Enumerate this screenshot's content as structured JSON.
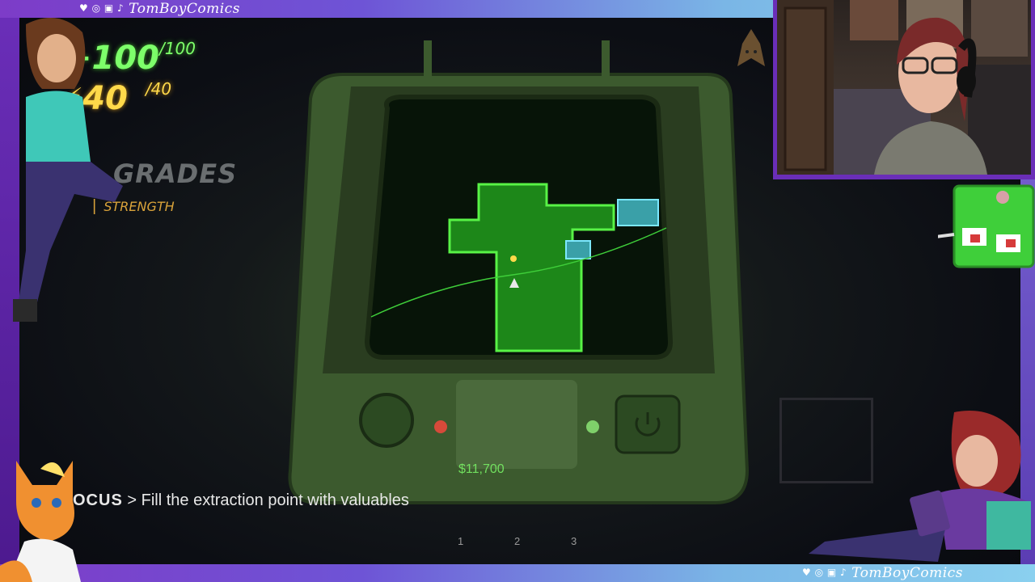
{
  "overlay": {
    "brand_top": "TomBoyComics",
    "brand_bottom": "TomBoyComics",
    "social_icons": "♥ ◎ ▣ ♪",
    "colors": {
      "frame_purple": "#6a2eb8",
      "frame_blue": "#8ad0ef",
      "hud_green": "#7dff6a",
      "hud_yellow": "#ffd94a"
    }
  },
  "hud": {
    "health_prefix": "+",
    "health": "100",
    "health_max": "/100",
    "energy_prefix": "⚡",
    "energy": "40",
    "energy_max": "/40",
    "upgrades_title": "GRADES",
    "upgrade_item": "STRENGTH"
  },
  "monitor": {
    "money": "$11,700"
  },
  "objective": {
    "label": "OCUS",
    "arrow": ">",
    "text": "Fill the extraction point with valuables"
  },
  "inventory": {
    "slots": [
      "1",
      "2",
      "3"
    ]
  },
  "icons": {
    "top_right": "bat-icon",
    "monitor_left_button": "round-button-icon",
    "monitor_right_button": "power-icon"
  }
}
